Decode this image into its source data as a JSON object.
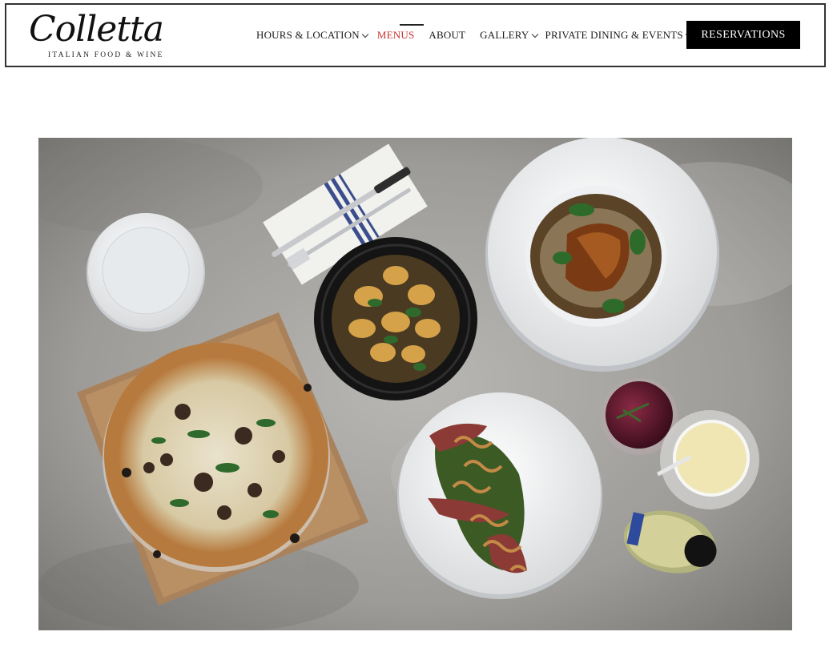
{
  "brand": {
    "name": "Colletta",
    "tagline": "ITALIAN FOOD & WINE"
  },
  "nav": {
    "items": [
      {
        "label": "HOURS & LOCATION",
        "has_dropdown": true
      },
      {
        "label": "MENUS",
        "has_dropdown": false,
        "active": true
      },
      {
        "label": "ABOUT",
        "has_dropdown": false
      },
      {
        "label": "GALLERY",
        "has_dropdown": true
      },
      {
        "label": "PRIVATE DINING & EVENTS",
        "has_dropdown": true
      }
    ],
    "cta_label": "RESERVATIONS"
  },
  "colors": {
    "active": "#c8322e",
    "cta_bg": "#000000",
    "border": "#333333"
  },
  "icons": {
    "dropdown": "chevron-down-icon"
  }
}
